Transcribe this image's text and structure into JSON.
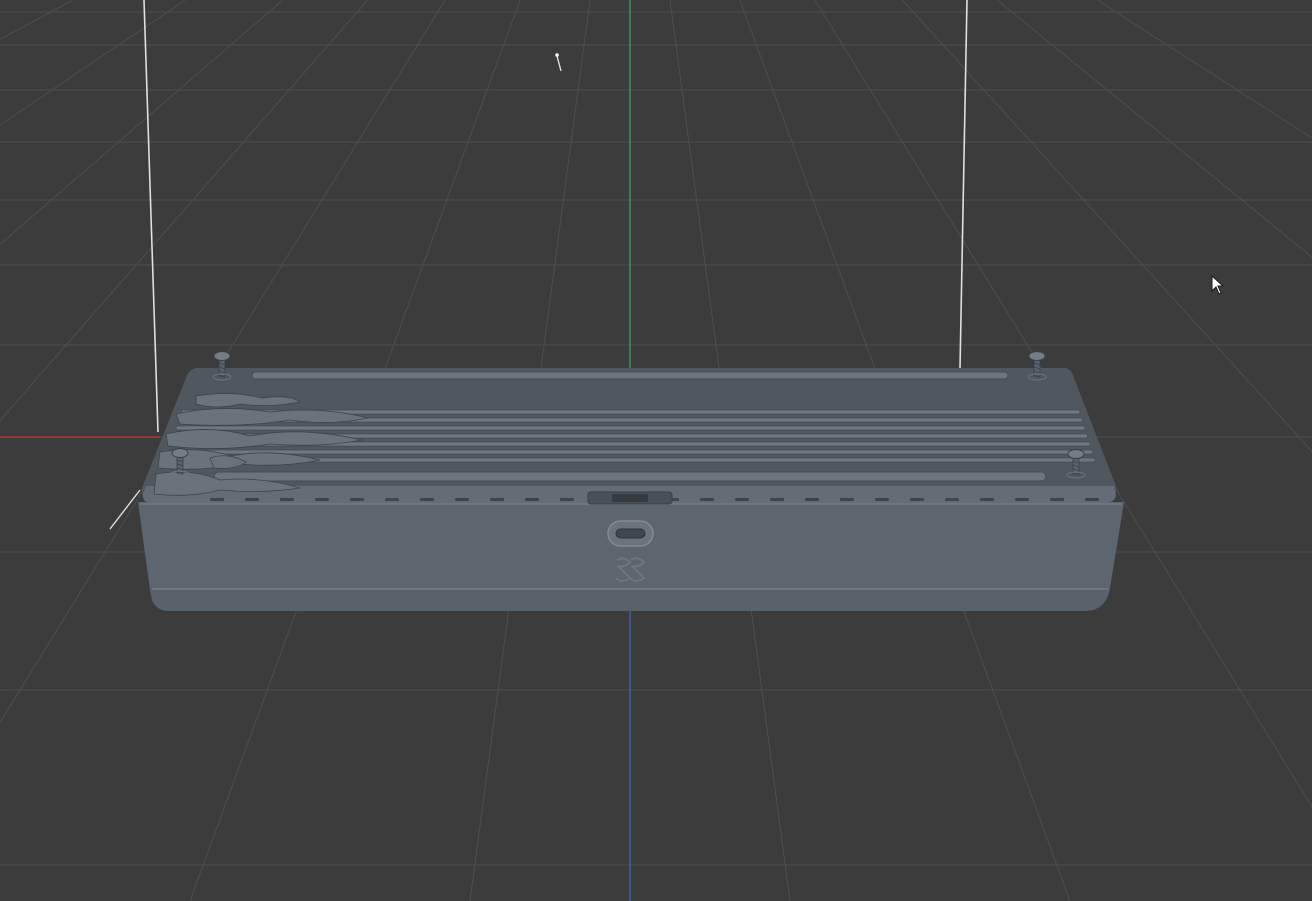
{
  "viewport": {
    "background": "#3c3c3c",
    "grid_color": "#4e4e4e",
    "x_axis_color": "#c43a3a",
    "y_axis_color": "#3aa86a",
    "z_axis_color": "#3a6ac4",
    "light_line_color": "#d8d8d8"
  },
  "model": {
    "name": "enclosure-case",
    "body_color": "#5f6770",
    "top_color": "#545b63",
    "rib_color": "#6f7881",
    "shadow_color": "#3f454c",
    "screw_count": 4,
    "rib_count": 9,
    "usb_port_count": 1
  },
  "cursor": {
    "icon": "pointer-arrow-icon",
    "color": "#ffffff"
  }
}
